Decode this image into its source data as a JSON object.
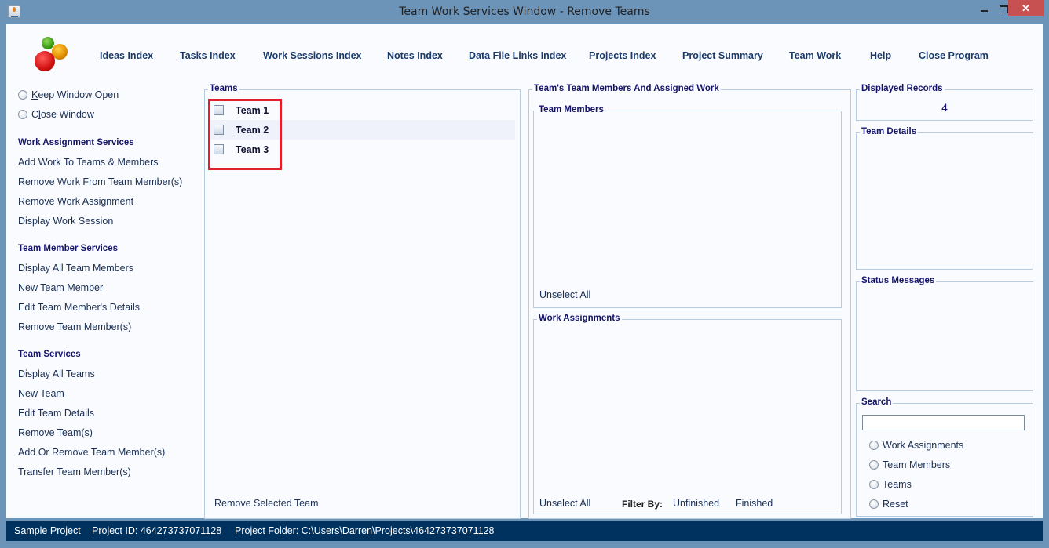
{
  "window": {
    "title": "Team Work Services Window - Remove Teams",
    "controls": {
      "minimize": "minimize",
      "maximize": "maximize",
      "close": "✕"
    }
  },
  "menu": [
    {
      "pre": "",
      "mnemonic": "I",
      "post": "deas Index"
    },
    {
      "pre": "",
      "mnemonic": "T",
      "post": "asks Index"
    },
    {
      "pre": "",
      "mnemonic": "W",
      "post": "ork Sessions Index"
    },
    {
      "pre": "",
      "mnemonic": "N",
      "post": "otes Index"
    },
    {
      "pre": "",
      "mnemonic": "D",
      "post": "ata File Links Index"
    },
    {
      "pre": "Projects Index",
      "mnemonic": "",
      "post": ""
    },
    {
      "pre": "",
      "mnemonic": "P",
      "post": "roject Summary"
    },
    {
      "pre": "T",
      "mnemonic": "e",
      "post": "am Work"
    },
    {
      "pre": "",
      "mnemonic": "H",
      "post": "elp"
    },
    {
      "pre": "",
      "mnemonic": "C",
      "post": "lose Program"
    }
  ],
  "sidebar": {
    "window_options": [
      {
        "pre": "",
        "mnemonic": "K",
        "post": "eep Window Open"
      },
      {
        "pre": "C",
        "mnemonic": "l",
        "post": "ose Window"
      }
    ],
    "sections": [
      {
        "heading": "Work Assignment Services",
        "items": [
          "Add Work To Teams & Members",
          "Remove Work From Team Member(s)",
          "Remove Work Assignment",
          "Display Work Session"
        ]
      },
      {
        "heading": "Team Member Services",
        "items": [
          "Display All Team Members",
          "New Team Member",
          "Edit Team Member's Details",
          "Remove Team Member(s)"
        ]
      },
      {
        "heading": "Team Services",
        "items": [
          "Display All Teams",
          "New Team",
          "Edit Team Details",
          "Remove Team(s)",
          "Add Or Remove Team Member(s)",
          "Transfer Team Member(s)"
        ]
      }
    ]
  },
  "teams_panel": {
    "title": "Teams",
    "teams": [
      {
        "label": "Team 1",
        "checked": false
      },
      {
        "label": "Team 2",
        "checked": false
      },
      {
        "label": "Team 3",
        "checked": false
      }
    ],
    "remove_button": "Remove Selected Team"
  },
  "members_work_panel": {
    "title": "Team's Team Members And Assigned Work",
    "team_members": {
      "title": "Team Members",
      "unselect_all": "Unselect All"
    },
    "work_assignments": {
      "title": "Work Assignments",
      "unselect_all": "Unselect All",
      "filter_label": "Filter By:",
      "filter_unfinished": "Unfinished",
      "filter_finished": "Finished"
    }
  },
  "right_panel": {
    "displayed_records": {
      "title": "Displayed Records",
      "value": "4"
    },
    "team_details": {
      "title": "Team Details"
    },
    "status_messages": {
      "title": "Status Messages"
    },
    "search": {
      "title": "Search",
      "value": "",
      "options": [
        "Work Assignments",
        "Team Members",
        "Teams",
        "Reset"
      ]
    }
  },
  "statusbar": {
    "project_name": "Sample Project",
    "project_id": "Project ID:  464273737071128",
    "project_folder": "Project Folder: C:\\Users\\Darren\\Projects\\464273737071128"
  },
  "colors": {
    "frame": "#6c93b8",
    "statusbar": "#00325f",
    "heading": "#14146a",
    "highlight": "#e0202a",
    "close_button": "#c75050"
  }
}
